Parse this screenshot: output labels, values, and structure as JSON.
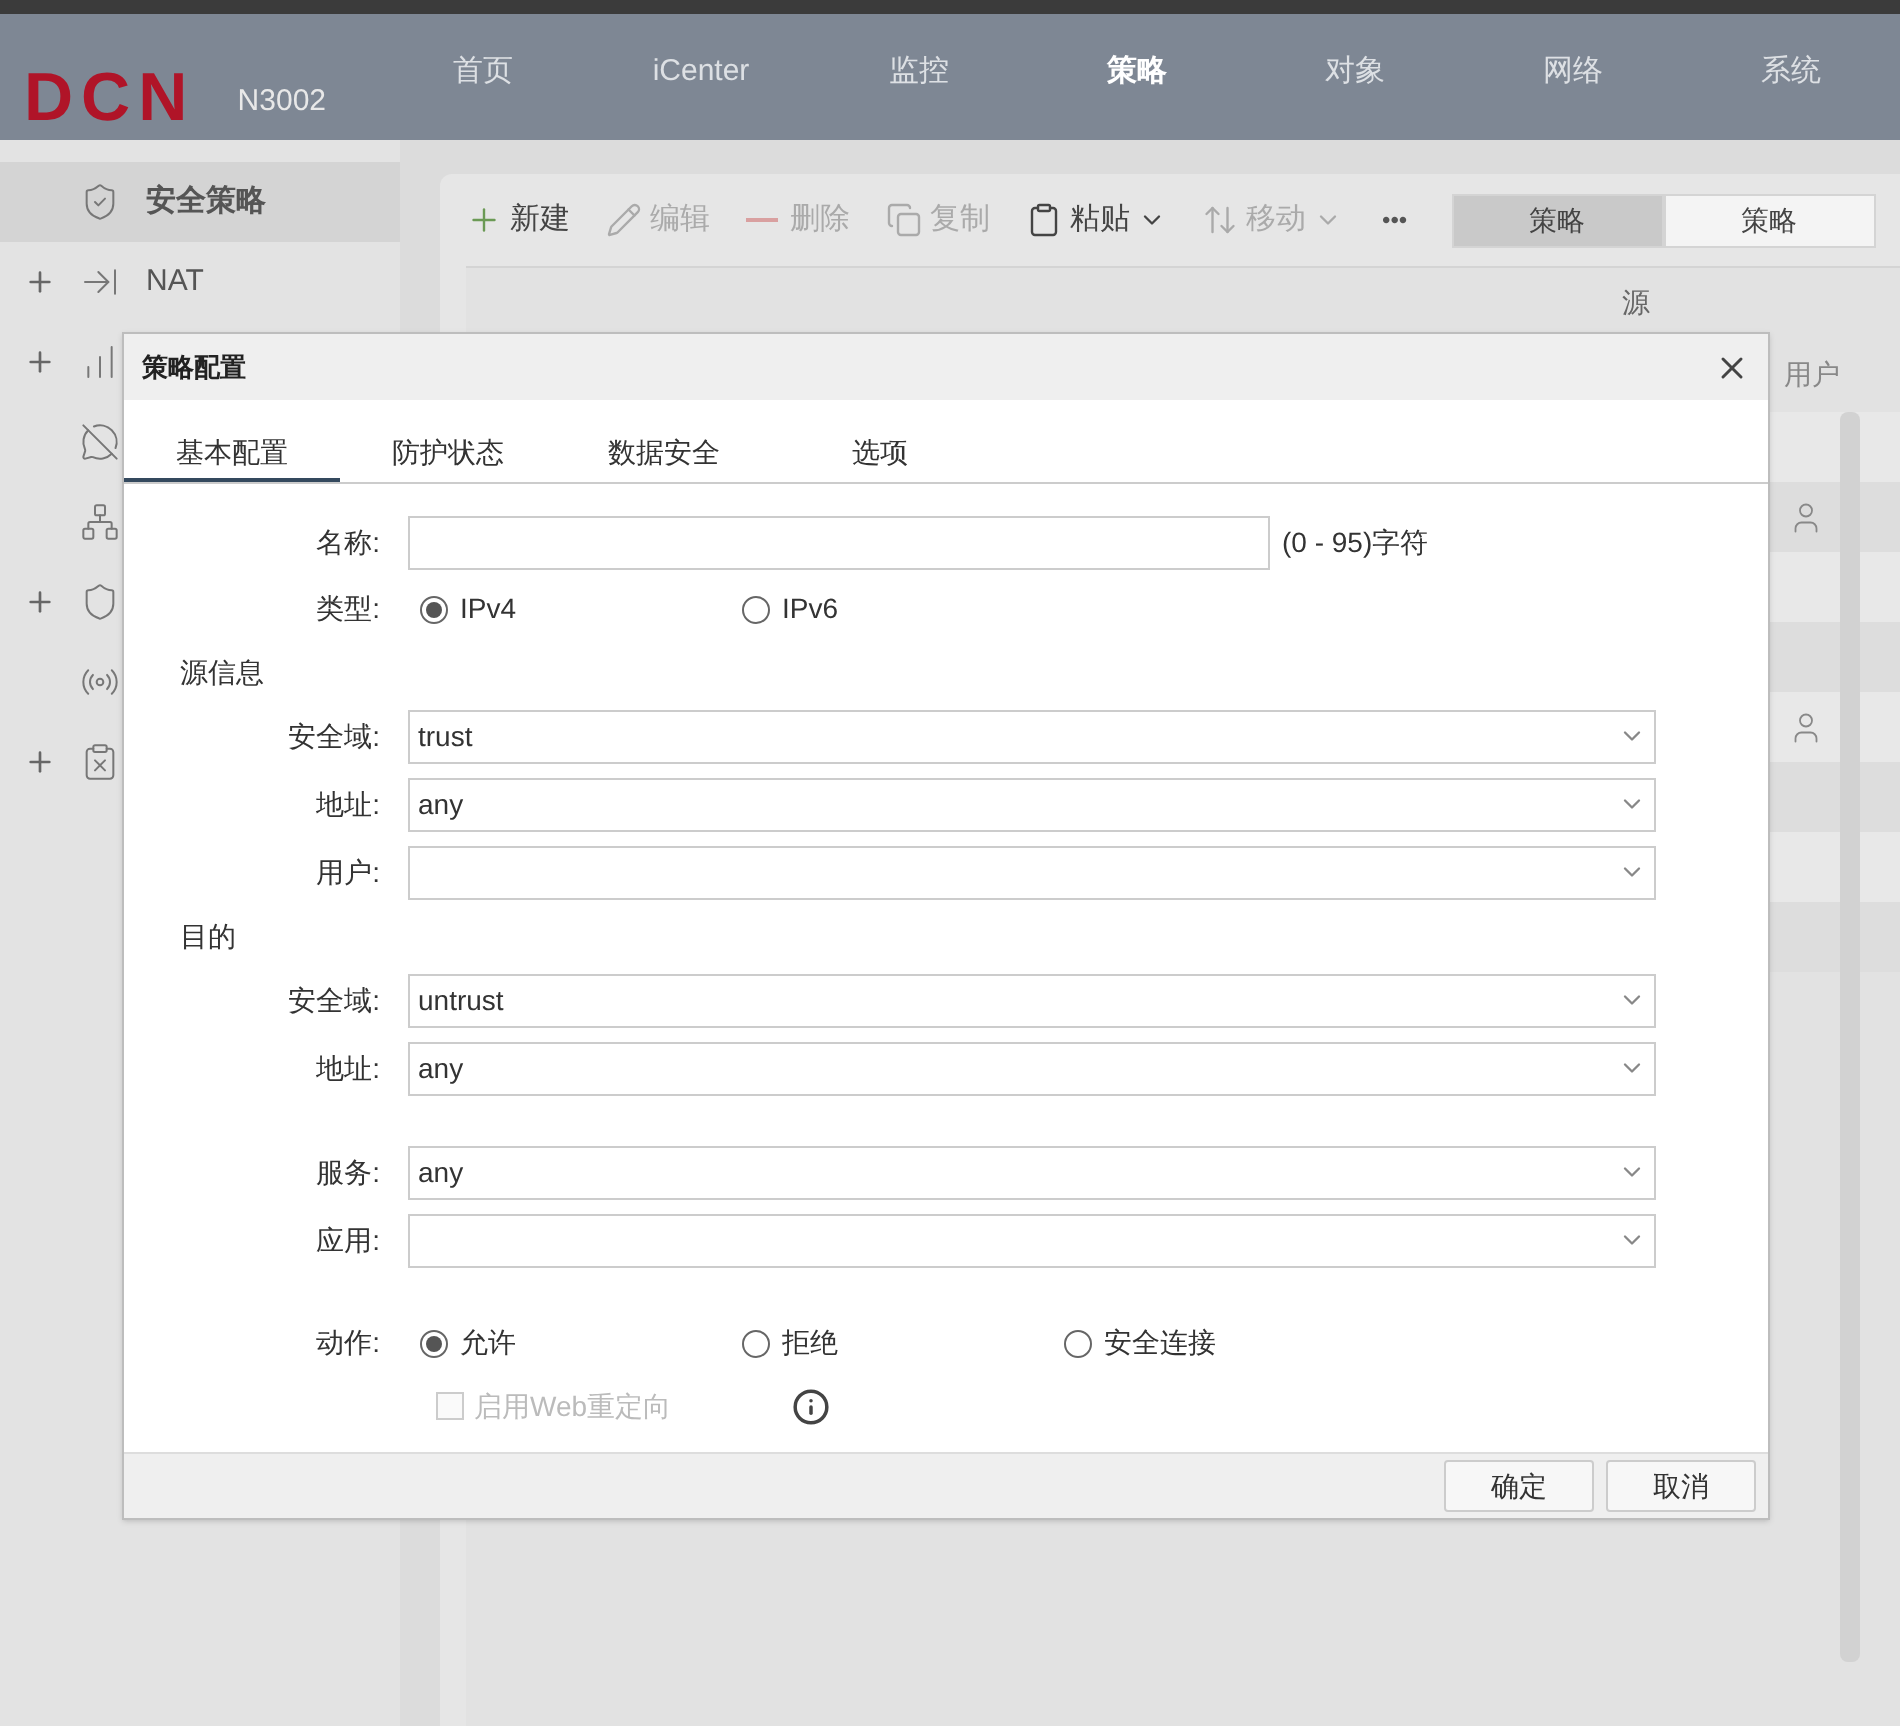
{
  "header": {
    "logo": "DCN",
    "model": "N3002",
    "nav": [
      {
        "label": "首页",
        "selected": false
      },
      {
        "label": "iCenter",
        "selected": false
      },
      {
        "label": "监控",
        "selected": false
      },
      {
        "label": "策略",
        "selected": true
      },
      {
        "label": "对象",
        "selected": false
      },
      {
        "label": "网络",
        "selected": false
      },
      {
        "label": "系统",
        "selected": false
      }
    ]
  },
  "sidebar": {
    "items": [
      {
        "label": "安全策略",
        "selected": true,
        "expandable": false
      },
      {
        "label": "NAT",
        "selected": false,
        "expandable": true
      },
      {
        "selected": false,
        "expandable": true
      },
      {
        "selected": false,
        "expandable": false
      },
      {
        "selected": false,
        "expandable": false
      },
      {
        "selected": false,
        "expandable": true
      },
      {
        "selected": false,
        "expandable": false
      },
      {
        "selected": false,
        "expandable": true
      }
    ]
  },
  "toolbar": {
    "buttons": [
      {
        "label": "新建",
        "disabled": false,
        "dropdown": false
      },
      {
        "label": "编辑",
        "disabled": true,
        "dropdown": false
      },
      {
        "label": "删除",
        "disabled": true,
        "dropdown": false
      },
      {
        "label": "复制",
        "disabled": true,
        "dropdown": false
      },
      {
        "label": "粘贴",
        "disabled": false,
        "dropdown": true
      },
      {
        "label": "移动",
        "disabled": true,
        "dropdown": true
      }
    ],
    "more": "•••",
    "view_tabs": [
      {
        "label": "策略",
        "selected": true
      },
      {
        "label": "策略",
        "selected": false
      }
    ]
  },
  "table": {
    "group_header": "源",
    "column_user": "用户",
    "rows": [
      {
        "user": false
      },
      {
        "user": true
      },
      {
        "user": false
      },
      {
        "user": false
      },
      {
        "user": true
      },
      {
        "user": false
      },
      {
        "user": false
      },
      {
        "user": false
      }
    ]
  },
  "dialog": {
    "title": "策略配置",
    "tabs": [
      {
        "label": "基本配置",
        "selected": true
      },
      {
        "label": "防护状态",
        "selected": false
      },
      {
        "label": "数据安全",
        "selected": false
      },
      {
        "label": "选项",
        "selected": false
      }
    ],
    "groups": [
      {
        "rows": [
          {
            "kind": "text",
            "label": "名称:",
            "hint": "(0 - 95)字符"
          },
          {
            "kind": "radio",
            "label": "类型:",
            "options": [
              {
                "label": "IPv4",
                "selected": true
              },
              {
                "label": "IPv6",
                "selected": false
              }
            ]
          },
          {
            "kind": "section",
            "label": "源信息"
          },
          {
            "kind": "select",
            "label": "安全域:",
            "value": "trust"
          },
          {
            "kind": "select",
            "label": "地址:",
            "value": "any"
          },
          {
            "kind": "select",
            "label": "用户:"
          },
          {
            "kind": "section",
            "label": "目的"
          },
          {
            "kind": "select",
            "label": "安全域:",
            "value": "untrust"
          },
          {
            "kind": "select",
            "label": "地址:",
            "value": "any"
          }
        ]
      },
      {
        "rows": [
          {
            "kind": "select",
            "label": "服务:",
            "value": "any"
          },
          {
            "kind": "select",
            "label": "应用:"
          }
        ]
      },
      {
        "rows": [
          {
            "kind": "radio",
            "label": "动作:",
            "options": [
              {
                "label": "允许",
                "selected": true
              },
              {
                "label": "拒绝",
                "selected": false
              },
              {
                "label": "安全连接",
                "selected": false
              }
            ]
          },
          {
            "kind": "checkbox",
            "label": "启用Web重定向",
            "checked": false,
            "disabled": true,
            "info": true
          }
        ]
      }
    ],
    "buttons": [
      "确定",
      "取消"
    ]
  }
}
